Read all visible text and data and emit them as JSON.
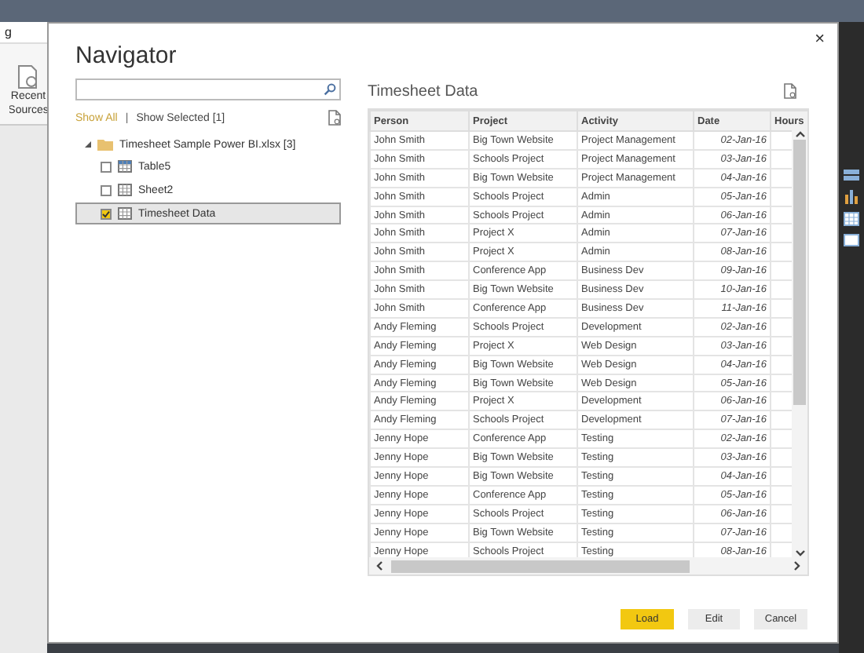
{
  "app": {
    "menu_label": "g",
    "ribbon_button": "Recent Sources"
  },
  "dialog": {
    "title": "Navigator",
    "close": "×"
  },
  "filter_separator": "|",
  "filters": [
    {
      "label": "Show All",
      "selected": true
    },
    {
      "label": "Show Selected [1]",
      "selected": false
    }
  ],
  "tree": {
    "label": "Timesheet Sample Power BI.xlsx [3]",
    "expanded": true,
    "children": [
      {
        "label": "Table5",
        "kind": "table",
        "checked": false,
        "selected": false
      },
      {
        "label": "Sheet2",
        "kind": "sheet",
        "checked": false,
        "selected": false
      },
      {
        "label": "Timesheet Data",
        "kind": "sheet",
        "checked": true,
        "selected": true
      }
    ]
  },
  "preview": {
    "title": "Timesheet Data",
    "columns": [
      "Person",
      "Project",
      "Activity",
      "Date",
      "Hours"
    ],
    "rows": [
      [
        "John Smith",
        "Big Town Website",
        "Project Management",
        "02-Jan-16"
      ],
      [
        "John Smith",
        "Schools Project",
        "Project Management",
        "03-Jan-16"
      ],
      [
        "John Smith",
        "Big Town Website",
        "Project Management",
        "04-Jan-16"
      ],
      [
        "John Smith",
        "Schools Project",
        "Admin",
        "05-Jan-16"
      ],
      [
        "John Smith",
        "Schools Project",
        "Admin",
        "06-Jan-16"
      ],
      [
        "John Smith",
        "Project X",
        "Admin",
        "07-Jan-16"
      ],
      [
        "John Smith",
        "Project X",
        "Admin",
        "08-Jan-16"
      ],
      [
        "John Smith",
        "Conference App",
        "Business Dev",
        "09-Jan-16"
      ],
      [
        "John Smith",
        "Big Town Website",
        "Business Dev",
        "10-Jan-16"
      ],
      [
        "John Smith",
        "Conference App",
        "Business Dev",
        "11-Jan-16"
      ],
      [
        "Andy Fleming",
        "Schools Project",
        "Development",
        "02-Jan-16"
      ],
      [
        "Andy Fleming",
        "Project X",
        "Web Design",
        "03-Jan-16"
      ],
      [
        "Andy Fleming",
        "Big Town Website",
        "Web Design",
        "04-Jan-16"
      ],
      [
        "Andy Fleming",
        "Big Town Website",
        "Web Design",
        "05-Jan-16"
      ],
      [
        "Andy Fleming",
        "Project X",
        "Development",
        "06-Jan-16"
      ],
      [
        "Andy Fleming",
        "Schools Project",
        "Development",
        "07-Jan-16"
      ],
      [
        "Jenny Hope",
        "Conference App",
        "Testing",
        "02-Jan-16"
      ],
      [
        "Jenny Hope",
        "Big Town Website",
        "Testing",
        "03-Jan-16"
      ],
      [
        "Jenny Hope",
        "Big Town Website",
        "Testing",
        "04-Jan-16"
      ],
      [
        "Jenny Hope",
        "Conference App",
        "Testing",
        "05-Jan-16"
      ],
      [
        "Jenny Hope",
        "Schools Project",
        "Testing",
        "06-Jan-16"
      ],
      [
        "Jenny Hope",
        "Big Town Website",
        "Testing",
        "07-Jan-16"
      ],
      [
        "Jenny Hope",
        "Schools Project",
        "Testing",
        "08-Jan-16"
      ]
    ]
  },
  "buttons": [
    {
      "label": "Load",
      "kind": "primary"
    },
    {
      "label": "Edit",
      "kind": "secondary"
    },
    {
      "label": "Cancel",
      "kind": "secondary"
    }
  ]
}
